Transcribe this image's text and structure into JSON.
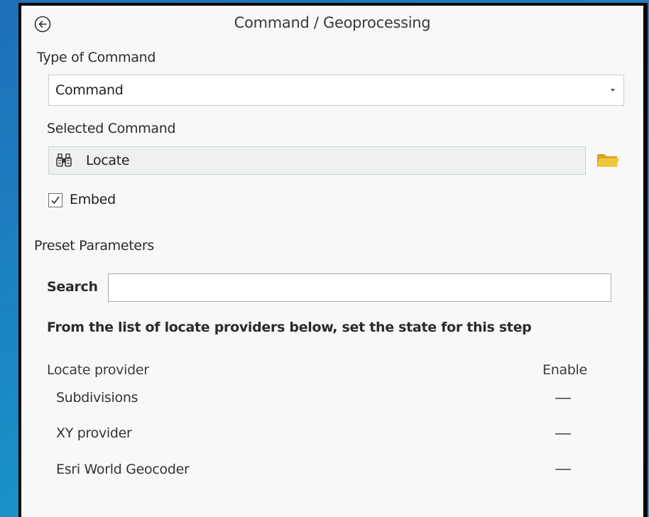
{
  "header": {
    "title": "Command / Geoprocessing",
    "back_icon": "back-arrow-circle-icon"
  },
  "type_of_command": {
    "label": "Type of Command",
    "selected": "Command"
  },
  "selected_command": {
    "label": "Selected Command",
    "value": "Locate",
    "icon": "binoculars-icon",
    "browse_icon": "folder-icon"
  },
  "embed": {
    "label": "Embed",
    "checked": true
  },
  "preset_parameters": {
    "label": "Preset Parameters",
    "search_label": "Search",
    "search_value": "",
    "instruction": "From the list of locate providers below, set the state for this step"
  },
  "providers": {
    "column_provider": "Locate provider",
    "column_enable": "Enable",
    "items": [
      {
        "name": "Subdivisions",
        "state": "indeterminate"
      },
      {
        "name": "XY provider",
        "state": "indeterminate"
      },
      {
        "name": "Esri World Geocoder",
        "state": "indeterminate"
      }
    ]
  },
  "colors": {
    "panel_background": "#f7f9f9",
    "folder_icon": "#e8b829",
    "desktop_blue": "#1a86c4"
  }
}
